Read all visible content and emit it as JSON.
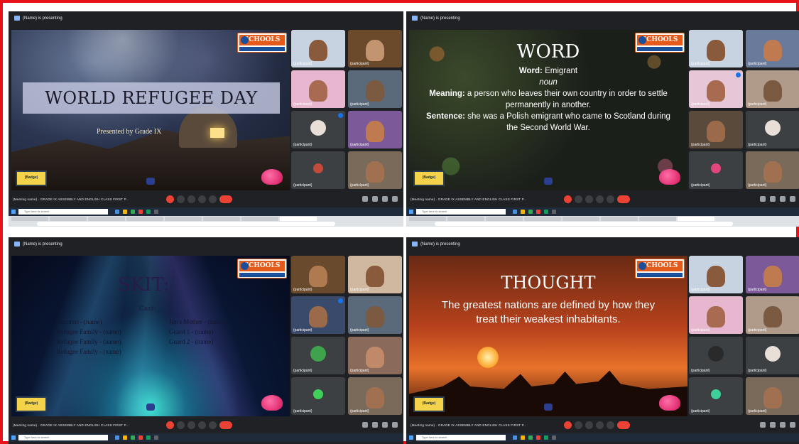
{
  "window": {
    "presenting_label": "(Name) is presenting",
    "meeting_title": "(Meeting name) · GRADE IX ASSEMBLY AND ENGLISH CLASS FIRST P...",
    "search_placeholder": "Type here to search"
  },
  "colors": {
    "frame_border": "#e8121a",
    "meet_bg": "#202124",
    "end_call": "#ea4335",
    "logo_orange": "#e25b1a",
    "logo_blue": "#1a4f9c"
  },
  "logo": {
    "name": "SCHOOLS",
    "badge": "(Badge)"
  },
  "slides": {
    "refugee": {
      "title": "WORLD REFUGEE DAY",
      "subtitle": "Presented by Grade IX"
    },
    "word": {
      "heading": "WORD",
      "word_label": "Word:",
      "word_value": "Emigrant",
      "pos": "noun",
      "meaning_label": "Meaning:",
      "meaning_value": "a person who leaves their own country in order to settle permanently in another.",
      "sentence_label": "Sentence:",
      "sentence_value": "she was a Polish emigrant who came to Scotland during the Second World War."
    },
    "skit": {
      "heading": "SKIT:",
      "cast_label": "Cast:",
      "cast_left": [
        "Narrator - (name)",
        "Refugee Family - (name)",
        "Refugee Family - (name)",
        "Refugee Family - (name)"
      ],
      "cast_right": [
        "Jim's Mother - (name)",
        "Guard 1 - (name)",
        "Guard 2 - (name)"
      ]
    },
    "thought": {
      "heading": "THOUGHT",
      "quote": "The greatest nations are defined by how they treat their weakest inhabitants."
    }
  },
  "participants": {
    "q1": [
      "(participant)",
      "(participant)",
      "(participant)",
      "(participant)",
      "(participant)",
      "(participant)",
      "(participant)",
      "(participant)"
    ],
    "q2": [
      "(participant)",
      "(participant)",
      "(participant)",
      "(participant)",
      "(participant)",
      "(participant)",
      "(participant)",
      "(participant)"
    ],
    "q3": [
      "(participant)",
      "(participant)",
      "(participant)",
      "(participant)",
      "(participant)",
      "(participant)",
      "(participant)",
      "(participant)"
    ],
    "q4": [
      "(participant)",
      "(participant)",
      "(participant)",
      "(participant)",
      "(participant)",
      "(participant)",
      "(participant)",
      "(participant)"
    ]
  }
}
